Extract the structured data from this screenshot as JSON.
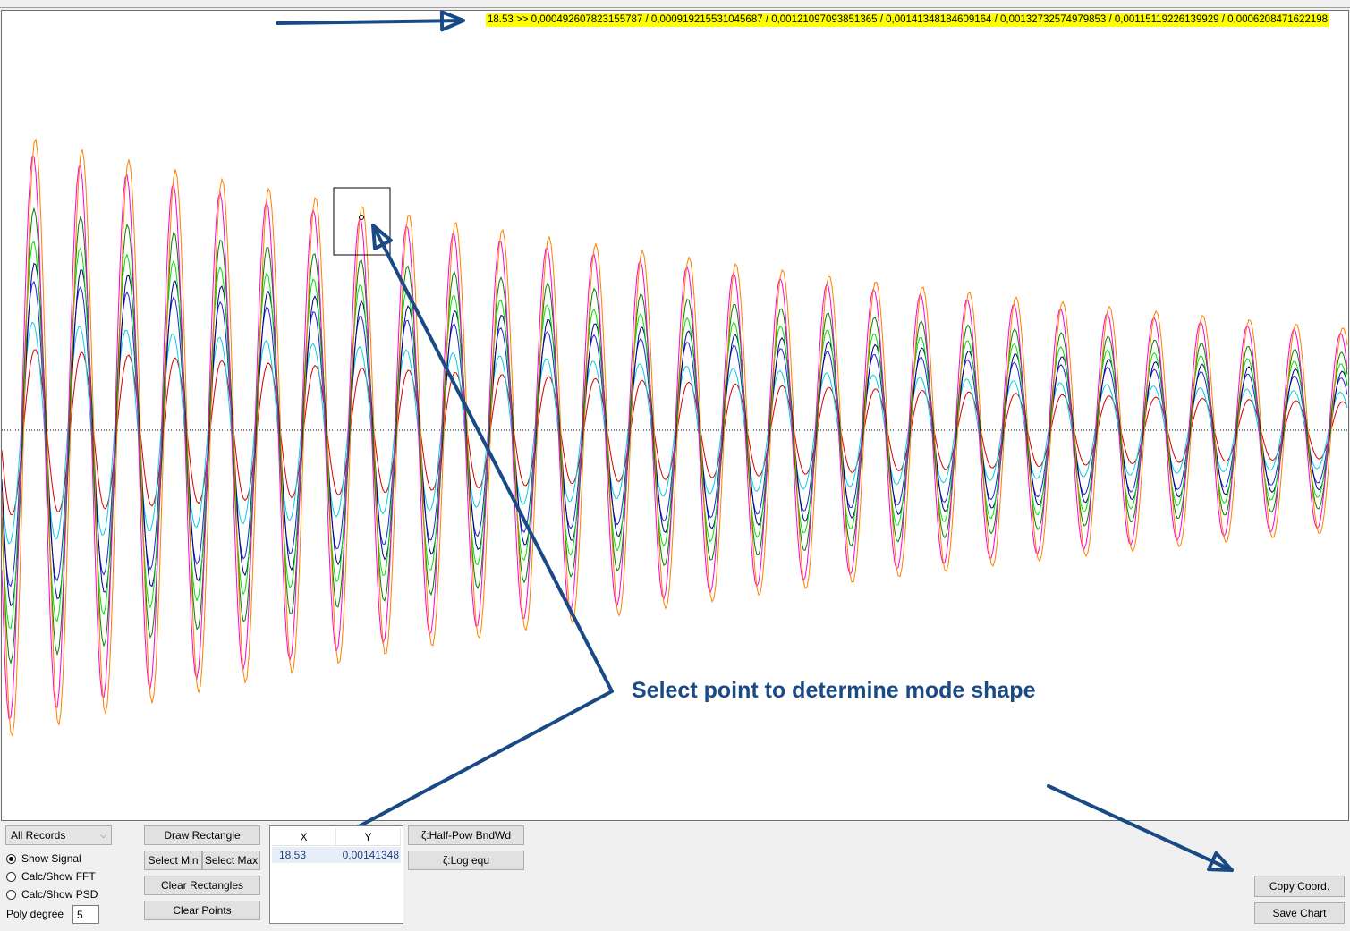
{
  "readout": {
    "text": "18.53 >> 0,000492607823155787 / 0,000919215531045687 / 0,00121097093851365 / 0,00141348184609164 / 0,00132732574979853 / 0,00115119226139929 / 0,0006208471622198"
  },
  "annotation": {
    "text": "Select point to determine mode shape",
    "color": "#1a4a86"
  },
  "chart": {
    "series_colors": [
      "#ff7f00",
      "#ff00d0",
      "#008000",
      "#00e000",
      "#000080",
      "#2020e0",
      "#00d0e0",
      "#d00000"
    ],
    "zero_line": "dotted"
  },
  "controls": {
    "records_select": {
      "value": "All Records",
      "icon": "chevron-down-icon"
    },
    "radios": [
      {
        "label": "Show Signal",
        "checked": true
      },
      {
        "label": "Calc/Show FFT",
        "checked": false
      },
      {
        "label": "Calc/Show PSD",
        "checked": false
      }
    ],
    "poly_label": "Poly degree",
    "poly_value": "5",
    "draw_rectangle": "Draw Rectangle",
    "select_min": "Select Min",
    "select_max": "Select Max",
    "clear_rectangles": "Clear Rectangles",
    "clear_points": "Clear Points",
    "half_power": "ζ:Half-Pow BndWd",
    "log_equ": "ζ:Log equ",
    "copy_coord": "Copy Coord.",
    "save_chart": "Save Chart"
  },
  "points_grid": {
    "headers": [
      "X",
      "Y"
    ],
    "rows": [
      [
        "18,53",
        "0,00141348"
      ]
    ]
  }
}
